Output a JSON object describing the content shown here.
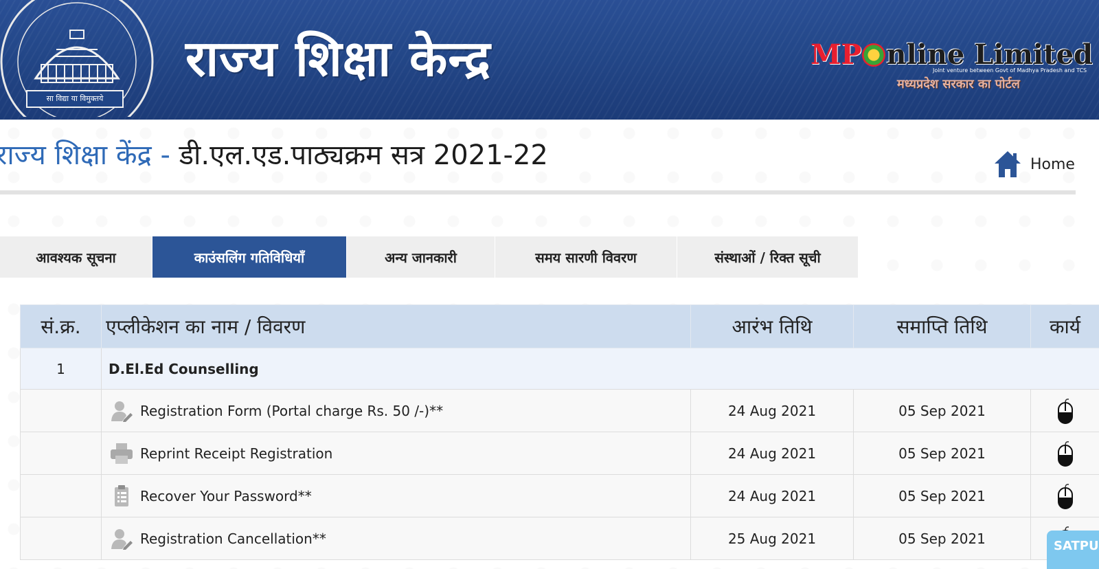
{
  "banner": {
    "title": "राज्य शिक्षा केन्द्र",
    "seal_motto": "सा विद्या या विमुक्तये",
    "partner_logo": {
      "prefix": "MP",
      "main": "nline Limited",
      "tagline": "Joint venture between Govt of Madhya Pradesh and TCS",
      "hindi": "मध्यप्रदेश सरकार का पोर्टल"
    }
  },
  "header": {
    "title_accent": "राज्य शिक्षा केंद्र - ",
    "title_main": "डी.एल.एड.पाठ्यक्रम सत्र 2021-22",
    "home_label": "Home"
  },
  "tabs": [
    {
      "label": "आवश्यक सूचना"
    },
    {
      "label": "काउंसलिंग गतिविधियाँ"
    },
    {
      "label": "अन्य जानकारी"
    },
    {
      "label": "समय सारणी विवरण"
    },
    {
      "label": "संस्थाओं / रिक्त सूची"
    }
  ],
  "active_tab_color": "#2c5597",
  "table": {
    "headers": {
      "sno": "सं.क्र.",
      "name": "एप्लीकेशन का नाम / विवरण",
      "start": "आरंभ तिथि",
      "end": "समाप्ति तिथि",
      "action": "कार्य"
    },
    "group": {
      "sno": "1",
      "name": "D.El.Ed Counselling"
    },
    "rows": [
      {
        "icon": "user-edit-icon",
        "name": "Registration Form (Portal charge Rs. 50 /-)**",
        "start": "24 Aug 2021",
        "end": "05 Sep 2021",
        "action_icon": "mouse-icon"
      },
      {
        "icon": "printer-icon",
        "name": "Reprint Receipt Registration",
        "start": "24 Aug 2021",
        "end": "05 Sep 2021",
        "action_icon": "mouse-icon"
      },
      {
        "icon": "clipboard-icon",
        "name": "Recover Your Password**",
        "start": "24 Aug 2021",
        "end": "05 Sep 2021",
        "action_icon": "mouse-icon"
      },
      {
        "icon": "user-edit-icon",
        "name": "Registration Cancellation**",
        "start": "25 Aug 2021",
        "end": "05 Sep 2021",
        "action_icon": "mouse-icon"
      }
    ]
  },
  "corner_badge": "SATPU"
}
